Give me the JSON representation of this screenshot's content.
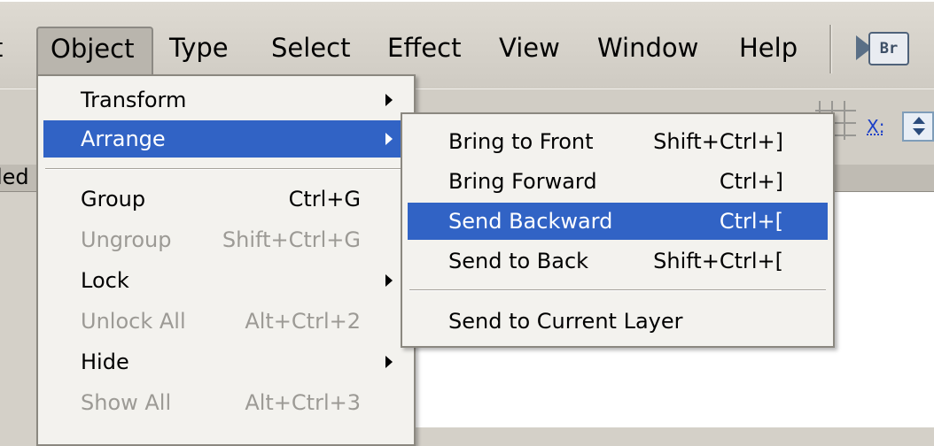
{
  "menubar": {
    "items": [
      {
        "label": "t"
      },
      {
        "label": "Object"
      },
      {
        "label": "Type"
      },
      {
        "label": "Select"
      },
      {
        "label": "Effect"
      },
      {
        "label": "View"
      },
      {
        "label": "Window"
      },
      {
        "label": "Help"
      }
    ],
    "bridge_button": {
      "label": "Br",
      "icon": "bridge-icon"
    }
  },
  "controlbar": {
    "x_label": "X:"
  },
  "panel_tab": {
    "label": "led"
  },
  "object_menu": {
    "items": [
      {
        "label": "Transform",
        "shortcut": "",
        "submenu": true,
        "enabled": true
      },
      {
        "label": "Arrange",
        "shortcut": "",
        "submenu": true,
        "enabled": true,
        "highlighted": true
      },
      {
        "label": "Group",
        "shortcut": "Ctrl+G",
        "submenu": false,
        "enabled": true
      },
      {
        "label": "Ungroup",
        "shortcut": "Shift+Ctrl+G",
        "submenu": false,
        "enabled": false
      },
      {
        "label": "Lock",
        "shortcut": "",
        "submenu": true,
        "enabled": true
      },
      {
        "label": "Unlock All",
        "shortcut": "Alt+Ctrl+2",
        "submenu": false,
        "enabled": false
      },
      {
        "label": "Hide",
        "shortcut": "",
        "submenu": true,
        "enabled": true
      },
      {
        "label": "Show All",
        "shortcut": "Alt+Ctrl+3",
        "submenu": false,
        "enabled": false
      }
    ]
  },
  "arrange_menu": {
    "items": [
      {
        "label": "Bring to Front",
        "shortcut": "Shift+Ctrl+]"
      },
      {
        "label": "Bring Forward",
        "shortcut": "Ctrl+]"
      },
      {
        "label": "Send Backward",
        "shortcut": "Ctrl+[",
        "highlighted": true
      },
      {
        "label": "Send to Back",
        "shortcut": "Shift+Ctrl+["
      },
      {
        "label": "Send to Current Layer",
        "shortcut": ""
      }
    ]
  },
  "colors": {
    "highlight": "#3163c5",
    "menu_bg": "#f3f2ee",
    "chrome": "#d4d0c8",
    "disabled_text": "#9c9a95"
  }
}
